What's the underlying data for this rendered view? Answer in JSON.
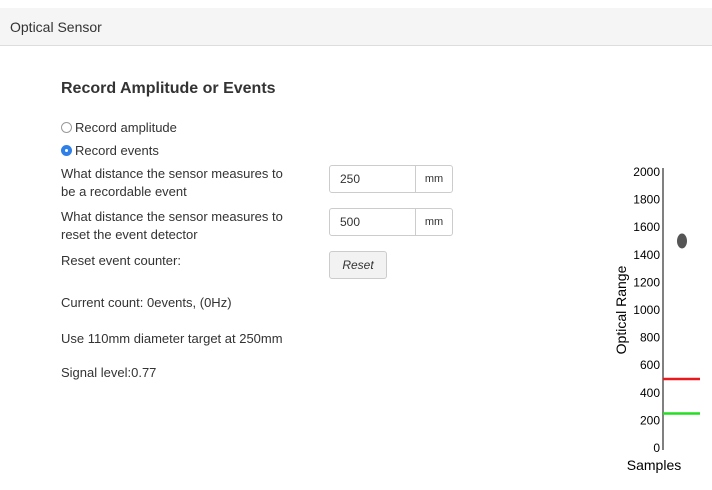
{
  "panel": {
    "title": "Optical Sensor"
  },
  "section": {
    "title": "Record Amplitude or Events"
  },
  "mode": {
    "options": [
      {
        "label": "Record amplitude",
        "checked": false
      },
      {
        "label": "Record events",
        "checked": true
      }
    ]
  },
  "fields": [
    {
      "label_line1": "What distance the sensor measures to",
      "label_line2": "be a recordable event",
      "value": "250",
      "unit": "mm"
    },
    {
      "label_line1": "What distance the sensor measures to",
      "label_line2": "reset the event detector",
      "value": "500",
      "unit": "mm"
    }
  ],
  "reset": {
    "label": "Reset event counter:",
    "button_label": "Reset"
  },
  "status": {
    "count_text": "Current count: 0events, (0Hz)",
    "target_text": "Use 110mm diameter target at 250mm",
    "signal_text": "Signal level:0.77"
  },
  "chart_data": {
    "type": "scatter",
    "ylabel": "Optical Range",
    "xlabel": "Samples",
    "ylim": [
      0,
      2000
    ],
    "y_ticks": [
      "2000",
      "1800",
      "1600",
      "1400",
      "1200",
      "1000",
      "800",
      "600",
      "400",
      "200",
      "0"
    ],
    "marker": {
      "value": 1500,
      "color": "#555555"
    },
    "thresholds": [
      {
        "value": 500,
        "color": "#e8191c"
      },
      {
        "value": 250,
        "color": "#22dd22"
      }
    ]
  }
}
